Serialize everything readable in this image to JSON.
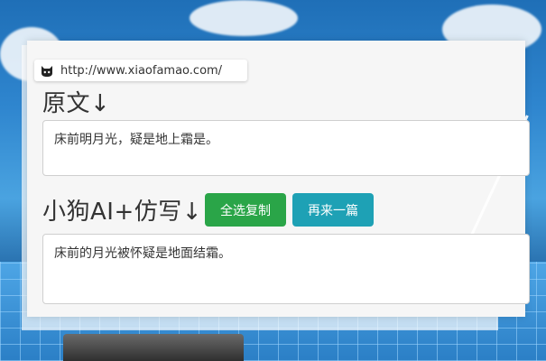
{
  "browser": {
    "url": "http://www.xiaofamao.com/",
    "logo_icon": "cat-face-icon"
  },
  "original": {
    "heading": "原文↓",
    "text": "床前明月光，疑是地上霜是。"
  },
  "rewrite": {
    "heading": "小狗AI+仿写↓",
    "copy_button": "全选复制",
    "again_button": "再来一篇",
    "text": "床前的月光被怀疑是地面结霜。"
  },
  "colors": {
    "copy_button_bg": "#2aa548",
    "again_button_bg": "#1ea1b5",
    "panel_bg": "#f6f6f6"
  }
}
